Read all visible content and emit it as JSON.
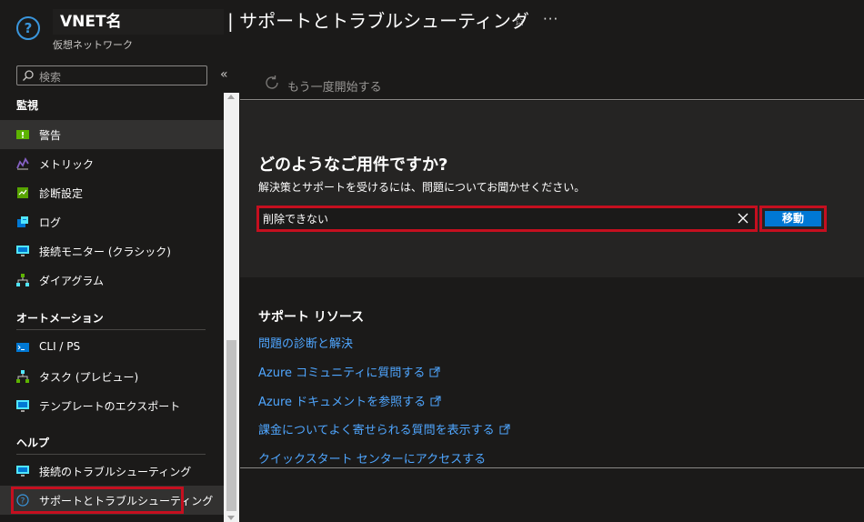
{
  "header": {
    "resource_name": "VNET名",
    "resource_type": "仮想ネットワーク",
    "title": "| サポートとトラブルシューティング"
  },
  "sidebar": {
    "search_placeholder": "検索",
    "sections": {
      "monitoring": "監視",
      "automation": "オートメーション",
      "help": "ヘルプ"
    },
    "items": [
      {
        "label": "警告",
        "icon": "alert-icon"
      },
      {
        "label": "メトリック",
        "icon": "metrics-icon"
      },
      {
        "label": "診断設定",
        "icon": "diagnostic-settings-icon"
      },
      {
        "label": "ログ",
        "icon": "logs-icon"
      },
      {
        "label": "接続モニター (クラシック)",
        "icon": "connection-monitor-icon"
      },
      {
        "label": "ダイアグラム",
        "icon": "diagram-icon"
      },
      {
        "label": "CLI / PS",
        "icon": "cli-icon"
      },
      {
        "label": "タスク (プレビュー)",
        "icon": "tasks-icon"
      },
      {
        "label": "テンプレートのエクスポート",
        "icon": "export-template-icon"
      },
      {
        "label": "接続のトラブルシューティング",
        "icon": "connection-troubleshoot-icon"
      },
      {
        "label": "サポートとトラブルシューティング",
        "icon": "support-icon"
      }
    ]
  },
  "main": {
    "restart_label": "もう一度開始する",
    "question": "どのようなご用件ですか?",
    "description": "解決策とサポートを受けるには、問題についてお聞かせください。",
    "issue_value": "削除できない",
    "go_label": "移動",
    "resources_title": "サポート リソース",
    "links": [
      "問題の診断と解決",
      "Azure コミュニティに質問する",
      "Azure ドキュメントを参照する",
      "課金についてよく寄せられる質問を表示する",
      "クイックスタート センターにアクセスする"
    ]
  },
  "colors": {
    "accent": "#0078d4",
    "link": "#4fa6ff",
    "highlight": "#c50f1f",
    "background": "#1b1a19"
  }
}
